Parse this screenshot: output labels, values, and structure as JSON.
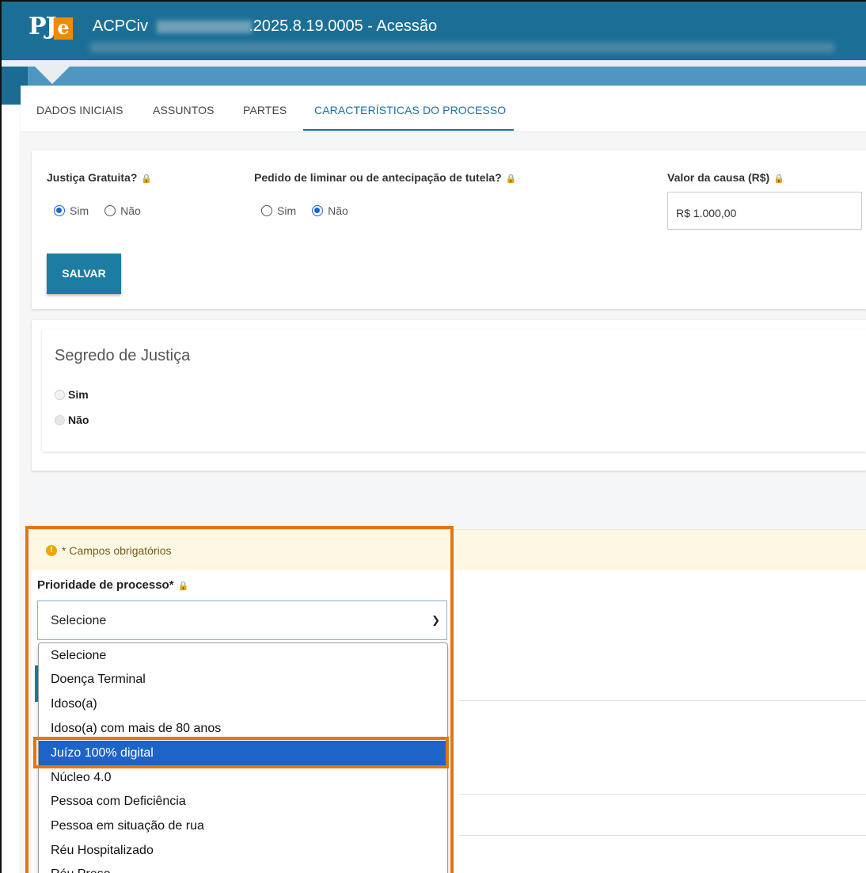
{
  "header": {
    "logo_text": "PJ",
    "logo_e": "e",
    "title_prefix": "ACPCiv",
    "title_suffix": ".2025.8.19.0005 - Acessão"
  },
  "tabs": [
    {
      "label": "DADOS INICIAIS"
    },
    {
      "label": "ASSUNTOS"
    },
    {
      "label": "PARTES"
    },
    {
      "label": "CARACTERÍSTICAS DO PROCESSO"
    }
  ],
  "form": {
    "justica": {
      "label": "Justiça Gratuita?",
      "options": [
        "Sim",
        "Não"
      ],
      "selected": "Sim"
    },
    "liminar": {
      "label": "Pedido de liminar ou de antecipação de tutela?",
      "options": [
        "Sim",
        "Não"
      ],
      "selected": "Não"
    },
    "valor": {
      "label": "Valor da causa (R$)",
      "value": "R$ 1.000,00"
    },
    "save_label": "SALVAR"
  },
  "segredo": {
    "title": "Segredo de Justiça",
    "options": [
      "Sim",
      "Não"
    ]
  },
  "warning": {
    "text": "* Campos obrigatórios"
  },
  "prioridade": {
    "label": "Prioridade de processo*",
    "selected": "Selecione",
    "options": [
      "Selecione",
      "Doença Terminal",
      "Idoso(a)",
      "Idoso(a) com mais de 80 anos",
      "Juízo 100% digital",
      "Núcleo 4.0",
      "Pessoa com Deficiência",
      "Pessoa em situação de rua",
      "Réu Hospitalizado",
      "Réu Preso"
    ],
    "highlighted": "Juízo 100% digital"
  },
  "colors": {
    "header": "#1b6f97",
    "accent": "#1e70a3",
    "highlight_border": "#e07616",
    "selected_option": "#1e64c8"
  }
}
